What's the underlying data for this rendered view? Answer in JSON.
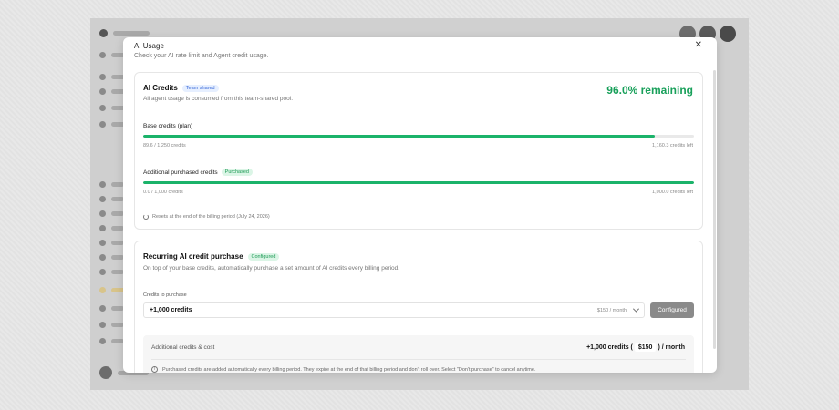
{
  "modal": {
    "title": "AI Usage",
    "subtitle": "Check your AI rate limit and Agent credit usage."
  },
  "ai_credits": {
    "title": "AI Credits",
    "badge": "Team shared",
    "description": "All agent usage is consumed from this team-shared pool.",
    "remaining": "96.0% remaining",
    "base": {
      "label": "Base credits (plan)",
      "used": "89.6 / 1,250 credits",
      "left": "1,160.3 credits left",
      "fill_fraction": 0.928
    },
    "additional": {
      "label": "Additional purchased credits",
      "badge": "Purchased",
      "used": "0.0 / 1,000 credits",
      "left": "1,000.0 credits left",
      "fill_fraction": 1.0
    },
    "reset_note": "Resets at the end of the billing period (July 24, 2026)"
  },
  "recurring": {
    "title": "Recurring AI credit purchase",
    "badge": "Configured",
    "description": "On top of your base credits, automatically purchase a set amount of AI credits every billing period.",
    "field_label": "Credits to purchase",
    "selected": "+1,000 credits",
    "selected_price": "$150  / month",
    "button": "Configured",
    "summary_label": "Additional credits & cost",
    "summary_prefix": "+1,000 credits (",
    "summary_price": "$150",
    "summary_suffix": ") / month",
    "info": "Purchased credits are added automatically every billing period. They expire at the end of that billing period and don't roll over. Select \"Don't purchase\" to cancel anytime."
  },
  "colors": {
    "accent_green": "#18a05a",
    "bar_green": "#1bb36a",
    "badge_blue": "#3868d8"
  }
}
